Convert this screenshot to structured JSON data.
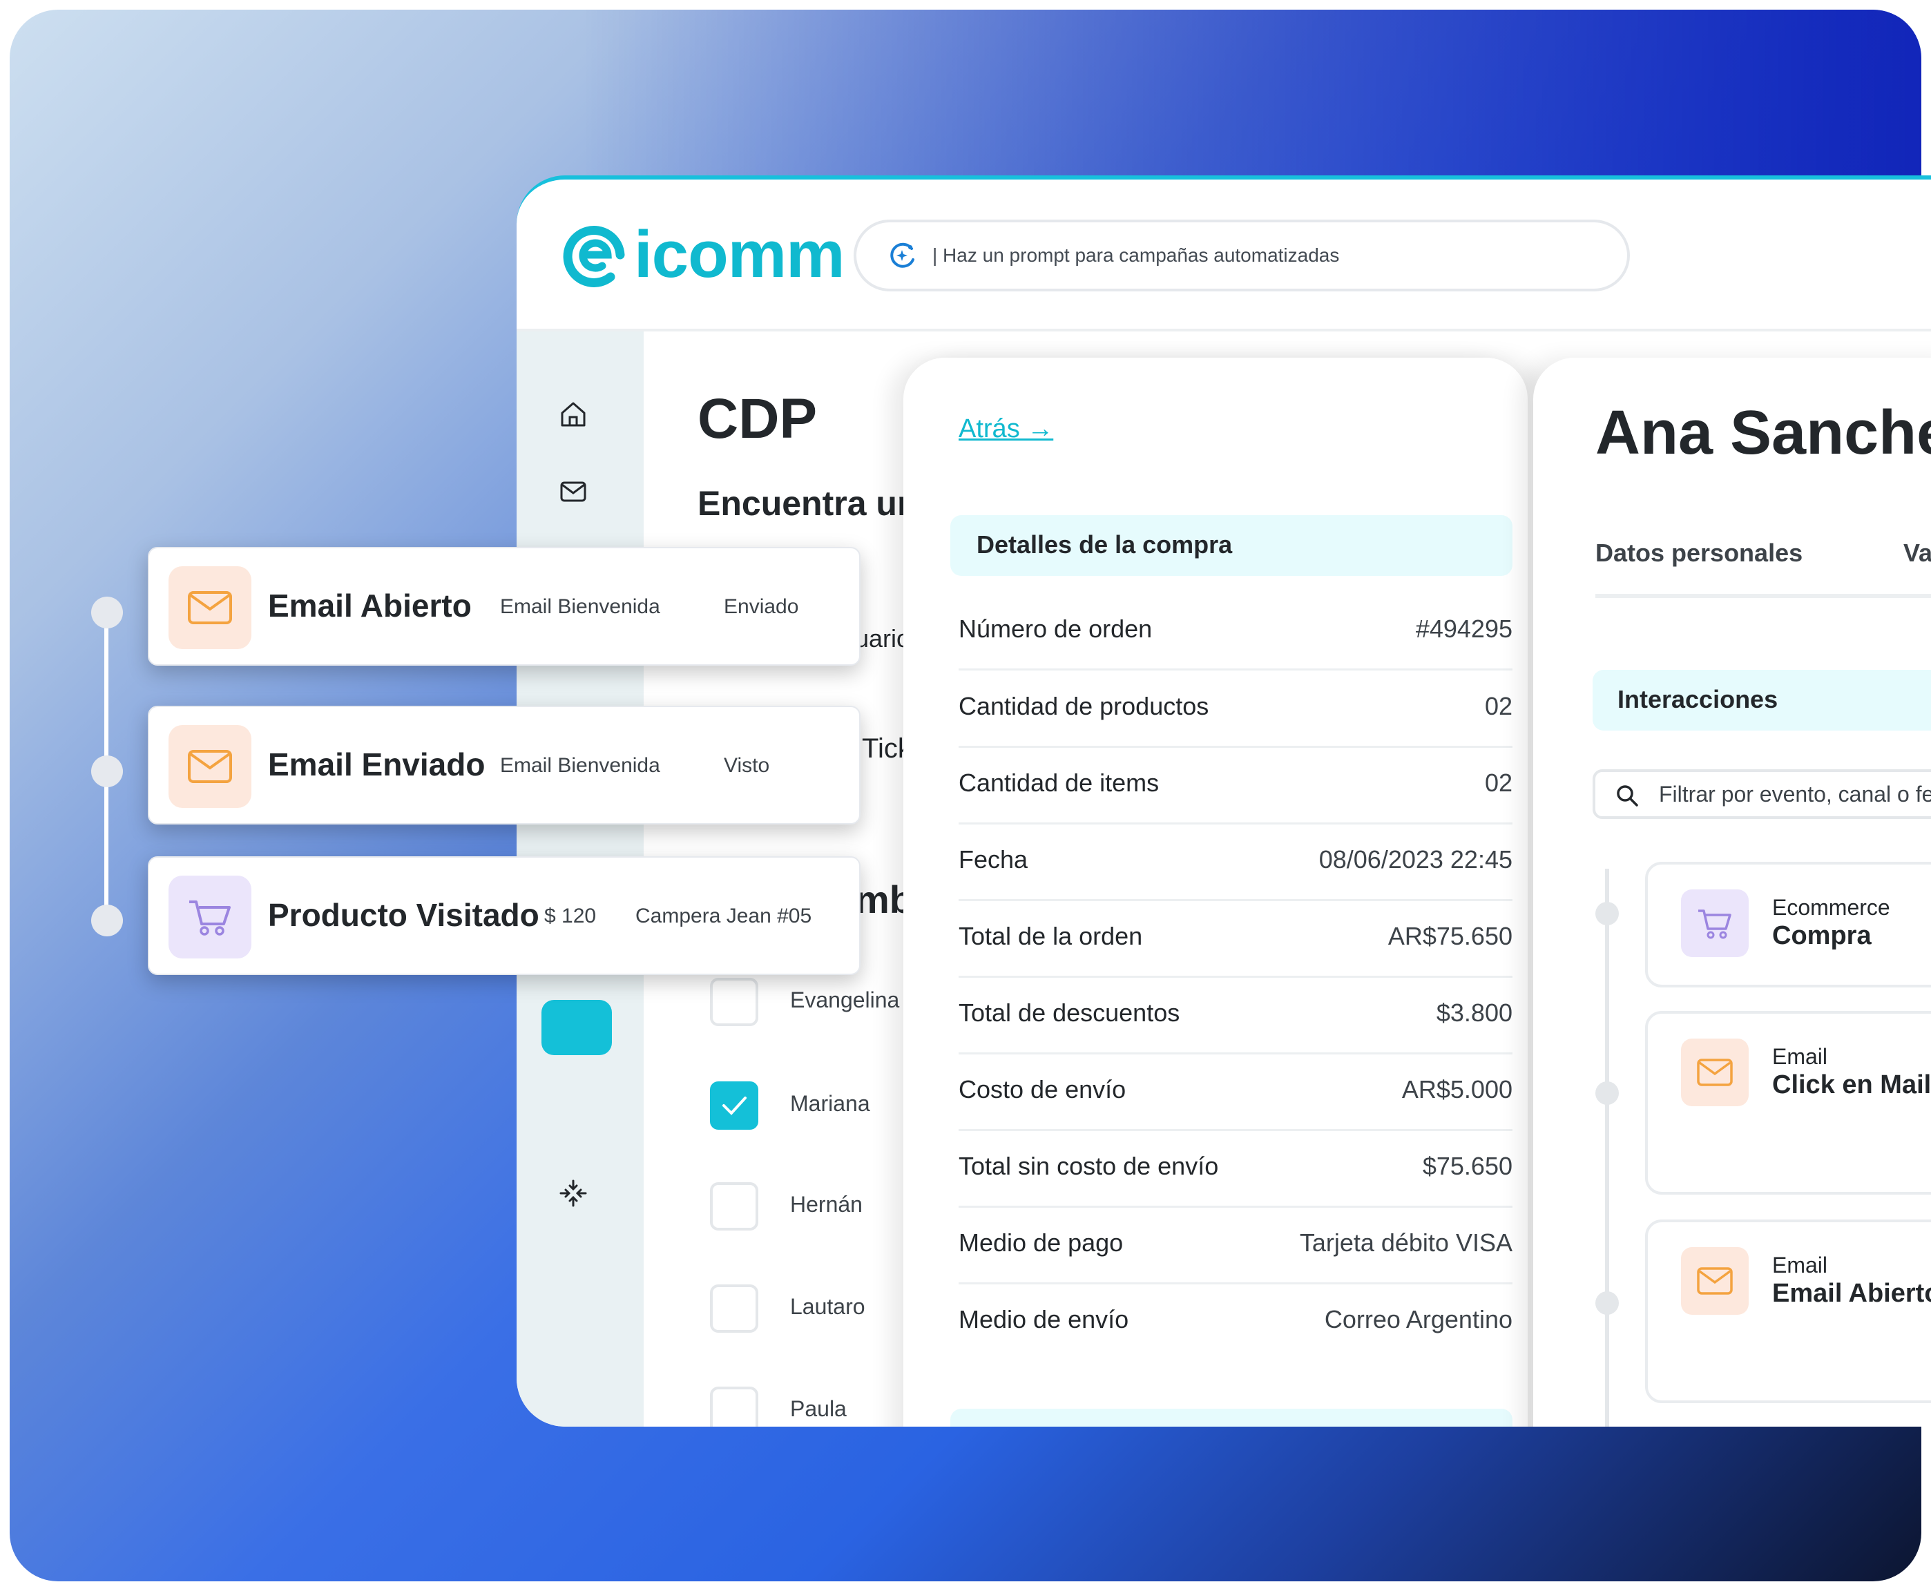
{
  "brand": {
    "name": "icomm",
    "color": "#10b9cf"
  },
  "search": {
    "placeholder": "| Haz un prompt para campañas automatizadas"
  },
  "sidebar": {
    "icons": [
      "home-icon",
      "mail-icon",
      "user-icon",
      "edit-icon",
      "card-icon",
      "compress-icon"
    ]
  },
  "cdp": {
    "title": "CDP",
    "subtitle_fragment": "Encuentra un",
    "frag_usuario": "uario",
    "frag_ticket": "Tick",
    "frag_nombre": "mbre",
    "names": [
      {
        "label": "Evangelina",
        "checked": false
      },
      {
        "label": "Mariana",
        "checked": true
      },
      {
        "label": "Hernán",
        "checked": false
      },
      {
        "label": "Lautaro",
        "checked": false
      },
      {
        "label": "Paula",
        "checked": false
      }
    ]
  },
  "details": {
    "back_link": "Atrás →",
    "header": "Detalles de la compra",
    "rows": [
      {
        "key": "Número de orden",
        "value": "#494295"
      },
      {
        "key": "Cantidad de productos",
        "value": "02"
      },
      {
        "key": "Cantidad de items",
        "value": "02"
      },
      {
        "key": "Fecha",
        "value": "08/06/2023 22:45"
      },
      {
        "key": "Total de la orden",
        "value": "AR$75.650"
      },
      {
        "key": "Total de descuentos",
        "value": "$3.800"
      },
      {
        "key": "Costo de envío",
        "value": "AR$5.000"
      },
      {
        "key": "Total sin costo de envío",
        "value": "$75.650"
      },
      {
        "key": "Medio de pago",
        "value": "Tarjeta débito VISA"
      },
      {
        "key": "Medio de envío",
        "value": "Correo Argentino"
      }
    ]
  },
  "profile": {
    "name": "Ana Sanchez",
    "tabs": [
      "Datos personales",
      "Va"
    ],
    "interactions_header": "Interacciones",
    "filter_placeholder": "Filtrar por evento, canal o fe",
    "events": [
      {
        "category": "Ecommerce",
        "event": "Compra",
        "icon": "cart-icon"
      },
      {
        "category": "Email",
        "event": "Click en Mail L",
        "icon": "mail-icon"
      },
      {
        "category": "Email",
        "event": "Email Abierto",
        "icon": "mail-icon"
      }
    ]
  },
  "floating_events": [
    {
      "title": "Email Abierto",
      "detail1": "Email Bienvenida",
      "detail2": "Enviado",
      "icon": "mail-icon"
    },
    {
      "title": "Email Enviado",
      "detail1": "Email Bienvenida",
      "detail2": "Visto",
      "icon": "mail-icon"
    },
    {
      "title": "Producto Visitado",
      "detail1": "$ 120",
      "detail2": "Campera Jean #05",
      "icon": "cart-icon"
    }
  ],
  "colors": {
    "accent": "#14c0d8",
    "email_icon_bg": "#fde8dd",
    "cart_icon_bg": "#ebe5fb",
    "email_icon": "#f4a340",
    "cart_icon": "#9b85e0"
  }
}
